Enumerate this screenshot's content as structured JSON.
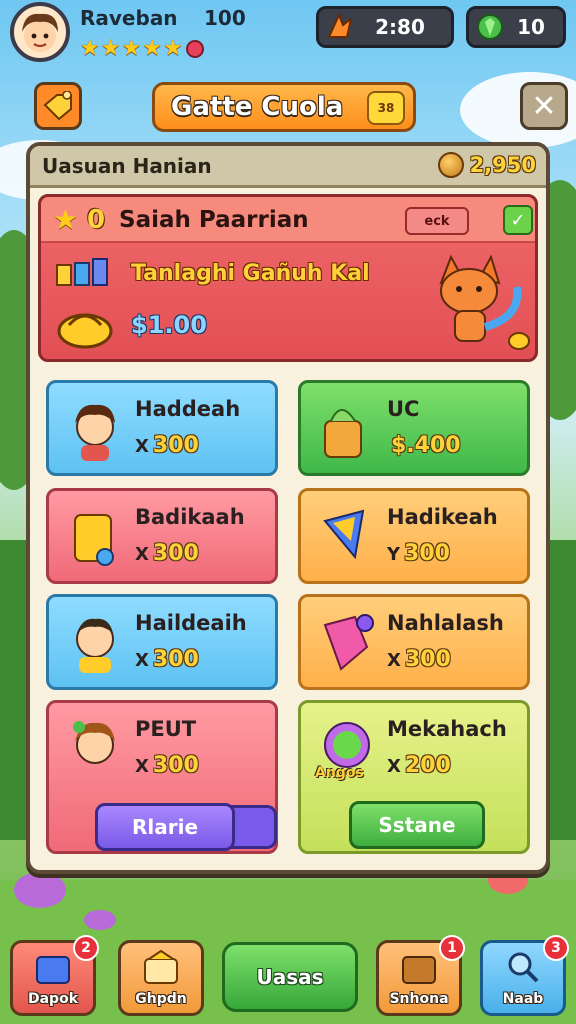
{
  "player": {
    "name": "Raveban",
    "level": "100",
    "stars": 5
  },
  "currency": {
    "timer": "2:80",
    "gems": "10"
  },
  "header": {
    "title": "Gatte Cuola",
    "badge": "38"
  },
  "panel": {
    "title": "Uasuan Hanian",
    "coins": "2,950"
  },
  "featured": {
    "zero": "0",
    "title": "Saiah Paarrian",
    "tag": "eck",
    "subtitle": "Tanlaghi Gañuh Kal",
    "price": "$1.00"
  },
  "cards": [
    {
      "name": "Haddeah",
      "mul": "X",
      "price": "300",
      "color": "blue"
    },
    {
      "name": "UC",
      "mul": "",
      "price": "$.400",
      "color": "green"
    },
    {
      "name": "Badikaah",
      "mul": "X",
      "price": "300",
      "color": "pink"
    },
    {
      "name": "Hadikeah",
      "mul": "Y",
      "price": "300",
      "color": "orange"
    },
    {
      "name": "Haildeaih",
      "mul": "X",
      "price": "300",
      "color": "blue"
    },
    {
      "name": "Nahlalash",
      "mul": "X",
      "price": "300",
      "color": "orange"
    },
    {
      "name": "PEUT",
      "mul": "X",
      "price": "300",
      "color": "pink",
      "button": "Rlarie"
    },
    {
      "name": "Mekahach",
      "mul": "X",
      "price": "200",
      "color": "lime",
      "button": "Sstane",
      "tag": "Angos"
    }
  ],
  "nav": [
    {
      "label": "Dapok",
      "badge": "2",
      "icon": "box-icon"
    },
    {
      "label": "Ghpdn",
      "badge": "",
      "icon": "chest-icon"
    },
    {
      "label": "Uasas",
      "badge": "",
      "icon": ""
    },
    {
      "label": "Snhona",
      "badge": "1",
      "icon": "crate-icon"
    },
    {
      "label": "Naab",
      "badge": "3",
      "icon": "search-icon"
    }
  ],
  "colors": {
    "accent": "#ff8e1c",
    "panel": "#f7f1de",
    "gold": "#ffd13a"
  }
}
